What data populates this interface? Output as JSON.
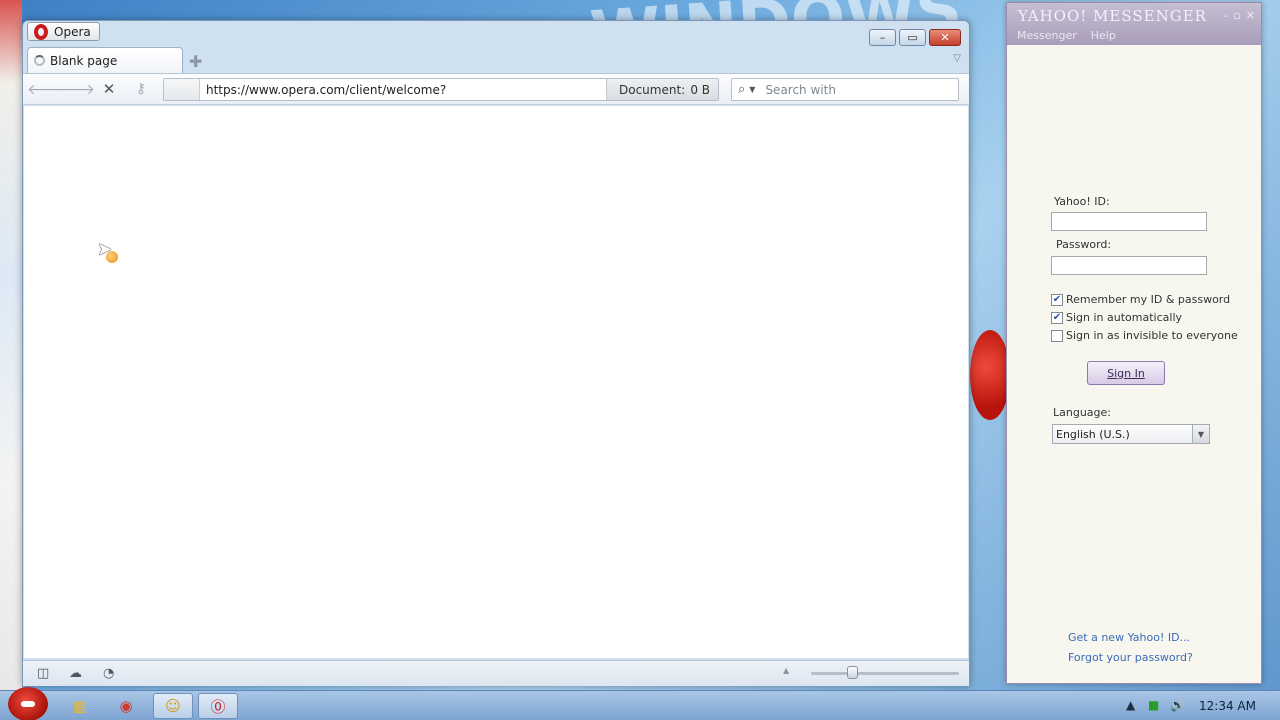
{
  "opera": {
    "app_name": "Opera",
    "tab_title": "Blank page",
    "address_url": "https://www.opera.com/client/welcome?",
    "document_label": "Document:",
    "document_size": "0 B",
    "search_placeholder": "Search with"
  },
  "yahoo": {
    "logo": "YAHOO! MESSENGER",
    "menu": [
      "Messenger",
      "Help"
    ],
    "id_label": "Yahoo! ID:",
    "password_label": "Password:",
    "options": [
      {
        "label": "Remember my ID & password",
        "checked": true
      },
      {
        "label": "Sign in automatically",
        "checked": true
      },
      {
        "label": "Sign in as invisible to everyone",
        "checked": false
      }
    ],
    "signin_label": "Sign In",
    "language_label": "Language:",
    "language_value": "English (U.S.)",
    "new_id_link": "Get a new Yahoo! ID...",
    "forgot_link": "Forgot your password?"
  },
  "taskbar": {
    "clock": "12:34 AM"
  },
  "icons": {
    "back": "back-arrow-icon",
    "forward": "forward-arrow-icon",
    "stop": "stop-icon",
    "key": "key-icon",
    "search": "search-icon"
  },
  "colors": {
    "opera_red": "#c91b1b",
    "yahoo_purple": "#a99db9",
    "link_blue": "#3a6cb5"
  }
}
